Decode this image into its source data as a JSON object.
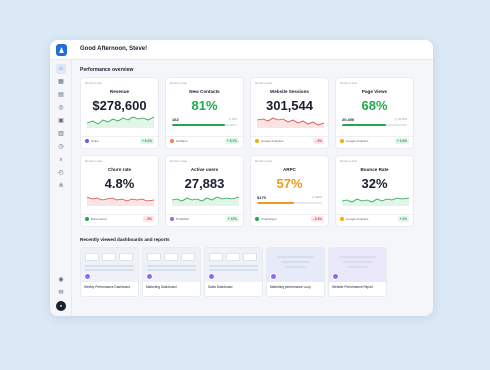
{
  "header": {
    "greeting": "Good Afternoon, Steve!"
  },
  "section": {
    "title": "Performance overview"
  },
  "colors": {
    "accent": "#1f6fd6",
    "green": "#20a84f",
    "red": "#e04444",
    "orange": "#ef9a1d"
  },
  "sidebar": {
    "icons": [
      "home-icon",
      "dashboard-icon",
      "chart-icon",
      "goals-icon",
      "calendar-icon",
      "reports-icon",
      "alerts-icon",
      "search-icon",
      "clock-icon",
      "integrations-icon",
      "help-icon",
      "mail-icon",
      "avatar"
    ]
  },
  "cards": [
    {
      "period": "Month to date",
      "title": "Revenue",
      "value": "$278,600",
      "value_color": "default",
      "chart": "green",
      "source": "Stripe",
      "source_color": "#635bff",
      "change": "+ 6.1%",
      "direction": "up"
    },
    {
      "period": "Month to date",
      "title": "New Contacts",
      "value": "81%",
      "value_color": "green",
      "sub": "162",
      "target": "200",
      "progress": 0.81,
      "bar_color": "#20a84f",
      "source": "HubSpot",
      "source_color": "#ff7a59",
      "change": "+ 5.1%",
      "direction": "up"
    },
    {
      "period": "Month to date",
      "title": "Website Sessions",
      "value": "301,544",
      "value_color": "default",
      "chart": "red",
      "source": "Google Analytics",
      "source_color": "#f9ab00",
      "change": "- 3%",
      "direction": "down"
    },
    {
      "period": "Month to date",
      "title": "Page Views",
      "value": "68%",
      "value_color": "green",
      "sub": "20,400",
      "target": "30,000",
      "progress": 0.68,
      "bar_color": "#20a84f",
      "source": "Google Analytics",
      "source_color": "#f9ab00",
      "change": "+ 3.4%",
      "direction": "up"
    },
    {
      "period": "Month to date",
      "title": "Churn rate",
      "value": "4.8%",
      "value_color": "default",
      "chart": "red",
      "source": "Baremetrics",
      "source_color": "#20a84f",
      "change": "- 5%",
      "direction": "down"
    },
    {
      "period": "Month to date",
      "title": "Active users",
      "value": "27,883",
      "value_color": "default",
      "chart": "green",
      "source": "ProfitWell",
      "source_color": "#8c6cf0",
      "change": "+ 12%",
      "direction": "up"
    },
    {
      "period": "Month to date",
      "title": "ARPC",
      "value": "57%",
      "value_color": "orange",
      "sub": "$170",
      "target": "$300",
      "progress": 0.57,
      "bar_color": "#ef9a1d",
      "source": "ChartMogul",
      "source_color": "#20a84f",
      "change": "- 3.4%",
      "direction": "down"
    },
    {
      "period": "Month to date",
      "title": "Bounce Rate",
      "value": "32%",
      "value_color": "default",
      "chart": "green",
      "source": "Google Analytics",
      "source_color": "#f9ab00",
      "change": "+ 2%",
      "direction": "up"
    }
  ],
  "recent": {
    "title": "Recently viewed dashboards and reports",
    "items": [
      {
        "label": "Weekly Performance Dashboard"
      },
      {
        "label": "Marketing Dashboard"
      },
      {
        "label": "Sales Dashboard"
      },
      {
        "label": "Marketing performance Loop"
      },
      {
        "label": "Website Performance Report"
      }
    ]
  }
}
